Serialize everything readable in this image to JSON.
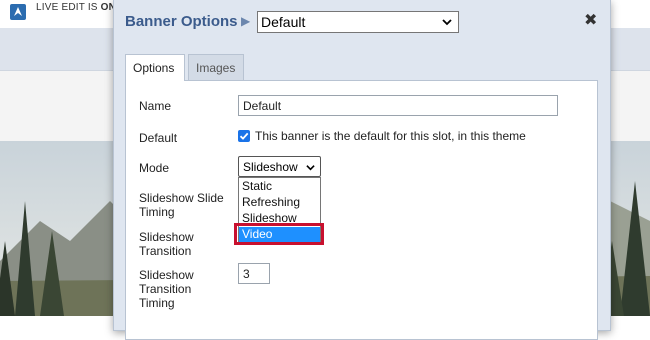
{
  "topbar": {
    "live_edit_label": "LIVE EDIT IS",
    "live_edit_state": "ON"
  },
  "dialog": {
    "title": "Banner Options",
    "banner_select_value": "Default",
    "close_glyph": "✖",
    "tabs": [
      {
        "label": "Options",
        "active": true
      },
      {
        "label": "Images",
        "active": false
      }
    ],
    "fields": {
      "name": {
        "label": "Name",
        "value": "Default"
      },
      "default": {
        "label": "Default",
        "checked": true,
        "checkbox_label": "This banner is the default for this slot, in this theme"
      },
      "mode": {
        "label": "Mode",
        "value": "Slideshow",
        "options": [
          "Static",
          "Refreshing",
          "Slideshow",
          "Video"
        ],
        "highlighted_option": "Video"
      },
      "slide_timing": {
        "label_line1": "Slideshow Slide",
        "label_line2": "Timing"
      },
      "transition": {
        "label_line1": "Slideshow",
        "label_line2": "Transition"
      },
      "transition_timing": {
        "label_line1": "Slideshow",
        "label_line2": "Transition",
        "label_line3": "Timing",
        "value": "3"
      }
    }
  },
  "colors": {
    "title_blue": "#3b5b8c",
    "dialog_bg": "#dfe6f0",
    "selection_blue": "#1e90ff",
    "highlight_red": "#c8102e"
  }
}
